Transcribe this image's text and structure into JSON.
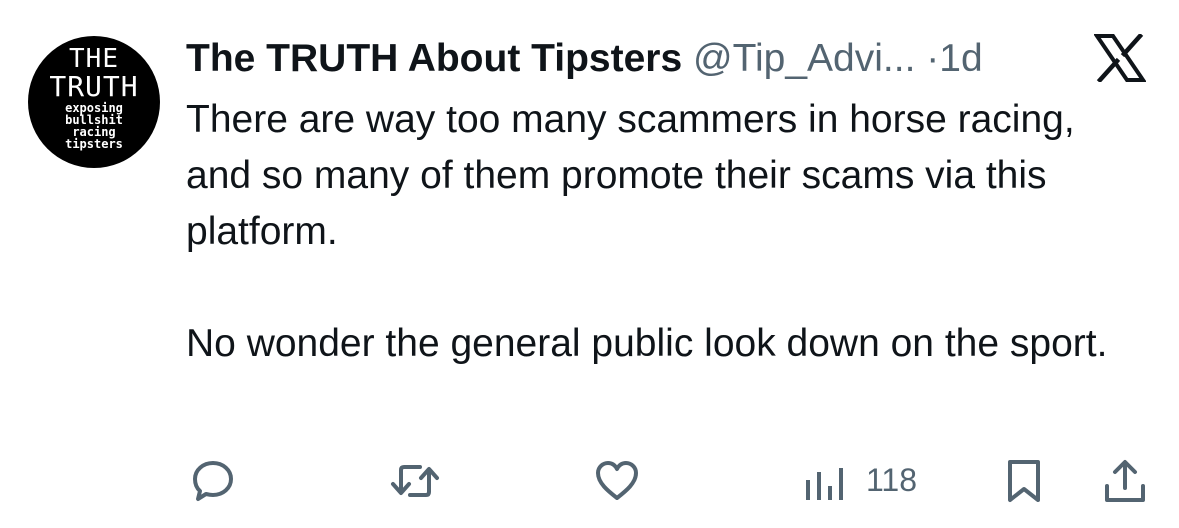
{
  "avatar": {
    "line1": "THE",
    "line2": "TRUTH",
    "line3": "exposing",
    "line4": "bullshit",
    "line5": "racing",
    "line6": "tipsters"
  },
  "header": {
    "display_name": "The TRUTH About Tipsters",
    "handle": "@Tip_Advi...",
    "separator": "·",
    "time": "1d",
    "platform_icon": "x-logo-icon"
  },
  "tweet": {
    "paragraph1": "There are way too many scammers in horse racing, and so many of them promote their scams via this platform.",
    "paragraph2": "No wonder the general public look down on the sport."
  },
  "actions": {
    "reply_icon": "reply-icon",
    "retweet_icon": "retweet-icon",
    "like_icon": "heart-icon",
    "views_icon": "views-icon",
    "views_count": "118",
    "bookmark_icon": "bookmark-icon",
    "share_icon": "share-icon"
  },
  "colors": {
    "text_primary": "#0f1419",
    "text_secondary": "#536471",
    "background": "#ffffff"
  }
}
